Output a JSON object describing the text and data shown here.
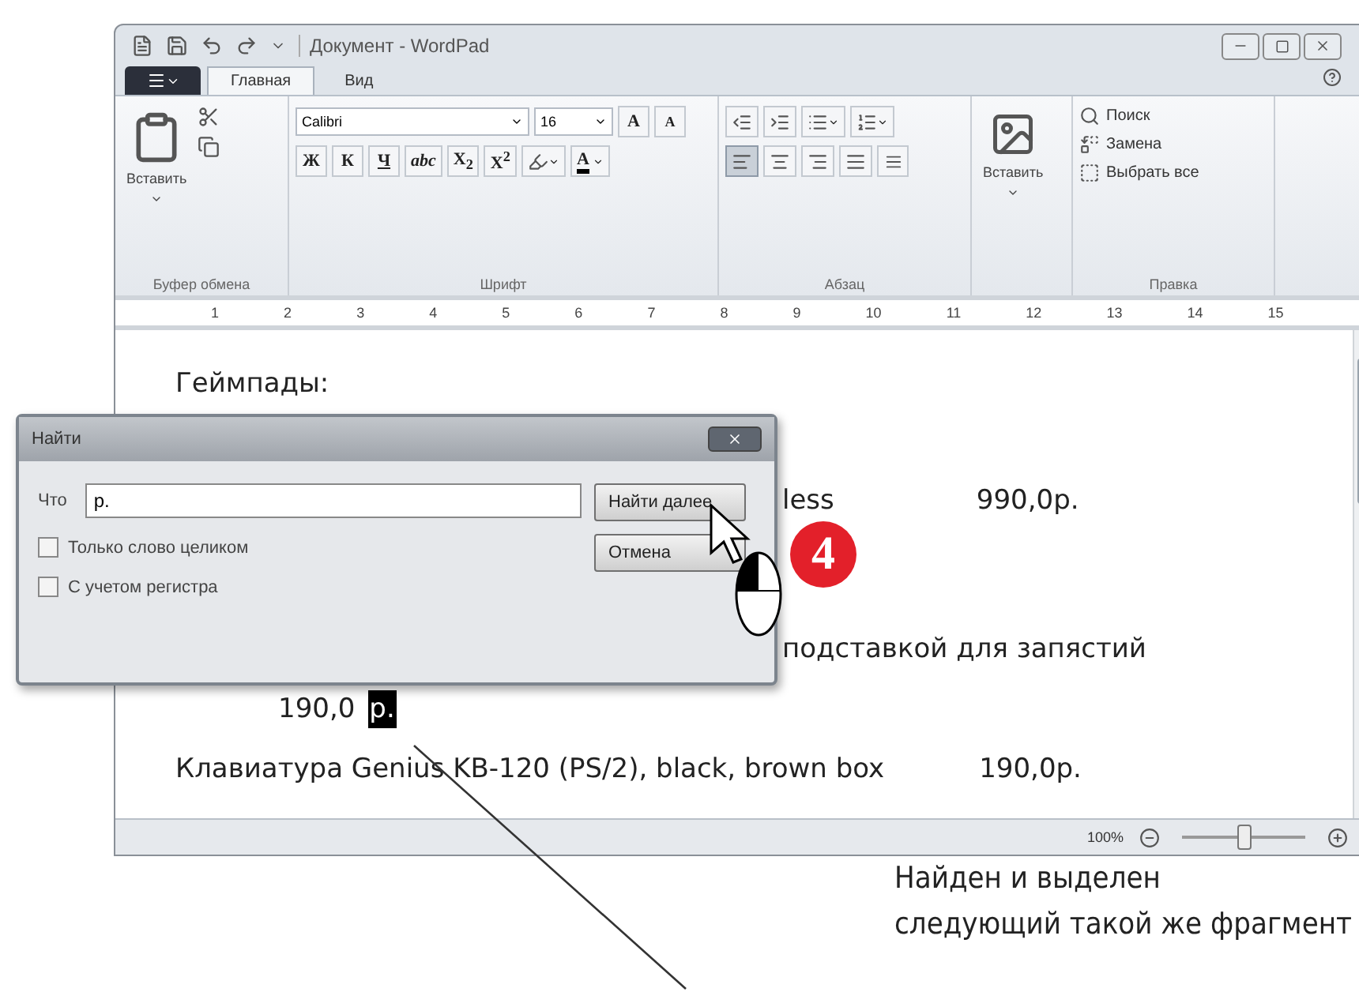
{
  "window": {
    "title": "Документ - WordPad"
  },
  "tabs": [
    {
      "label": "Главная",
      "selected": true
    },
    {
      "label": "Вид",
      "selected": false
    }
  ],
  "ribbon": {
    "clipboard": {
      "paste": "Вставить",
      "label": "Буфер обмена"
    },
    "font": {
      "name": "Calibri",
      "size": "16",
      "label": "Шрифт",
      "grow": "A",
      "shrink": "A",
      "font_color_letter": "A",
      "buttons": [
        {
          "kind": "text",
          "text": "Ж"
        },
        {
          "kind": "text",
          "text": "К"
        },
        {
          "kind": "underline",
          "text": "Ч"
        },
        {
          "kind": "strike",
          "text": "abc"
        },
        {
          "kind": "text",
          "text": "X$_{2}$"
        },
        {
          "kind": "text",
          "text": "X$^{2}$"
        }
      ]
    },
    "paragraph": {
      "label": "Абзац",
      "align": [
        {
          "kind": "left",
          "selected": true
        },
        {
          "kind": "center",
          "selected": false
        },
        {
          "kind": "right",
          "selected": false
        },
        {
          "kind": "justify",
          "selected": false
        }
      ]
    },
    "insert": {
      "label": "Вставить"
    },
    "editing": {
      "label": "Правка",
      "items": [
        {
          "kind": "find",
          "text": "Поиск"
        },
        {
          "kind": "replace",
          "text": "Замена"
        },
        {
          "kind": "select",
          "text": "Выбрать все"
        }
      ]
    }
  },
  "ruler": [
    "1",
    "2",
    "3",
    "4",
    "5",
    "6",
    "7",
    "8",
    "9",
    "10",
    "11",
    "12",
    "13",
    "14",
    "15"
  ],
  "document": [
    {
      "kind": "heading",
      "text": "Геймпады:"
    },
    {
      "kind": "tail",
      "text": "less",
      "price": "990,0р."
    },
    {
      "kind": "tail2",
      "text": "подставкой для запястий"
    },
    {
      "kind": "price",
      "text": "190,0",
      "highlight": "р."
    },
    {
      "kind": "item",
      "text": "Клавиатура Genius KB-120 (PS/2), black, brown box",
      "price": "190,0р."
    }
  ],
  "status_bar": {
    "zoom": "100%",
    "level": 0.5
  },
  "find_dialog": {
    "title": "Найти",
    "label": "Что",
    "value": "р.",
    "buttons": [
      "Найти далее",
      "Отмена"
    ],
    "options": [
      {
        "label": "Только слово целиком",
        "checked": false
      },
      {
        "label": "С учетом регистра",
        "checked": false
      }
    ]
  },
  "step_badge": "4",
  "caption": "Найден и выделен\nследующий такой же фрагмент"
}
